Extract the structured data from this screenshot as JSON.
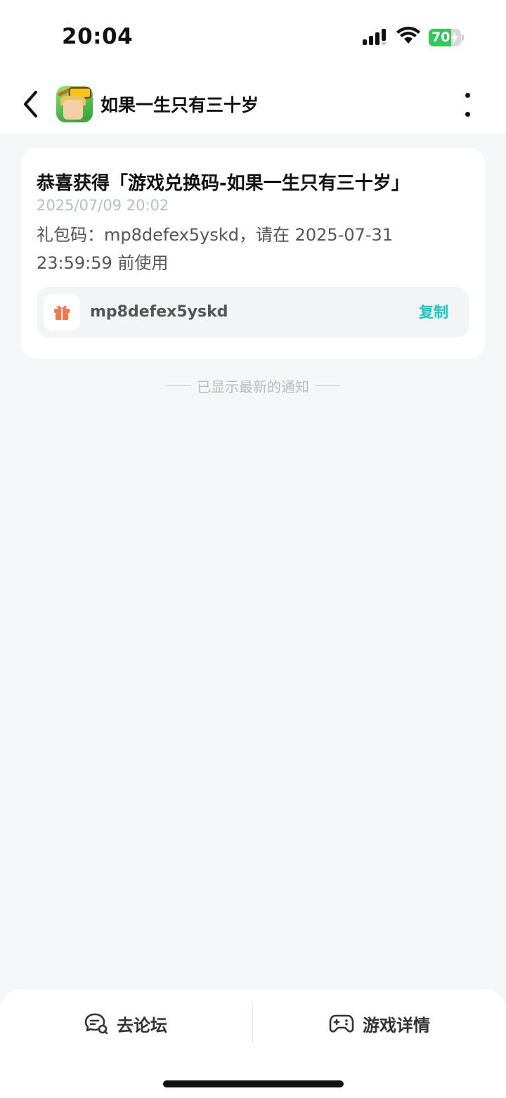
{
  "status_bar": {
    "time": "20:04",
    "battery_level": "70",
    "battery_fraction": 0.7,
    "signal_icon": "cellular-signal-icon",
    "wifi_icon": "wifi-icon"
  },
  "nav": {
    "title": "如果一生只有三十岁",
    "back_icon": "chevron-left-icon",
    "more_icon": "more-vertical-icon"
  },
  "notification": {
    "title": "恭喜获得「游戏兑换码-如果一生只有三十岁」",
    "time": "2025/07/09 20:02",
    "body": "礼包码：mp8defex5yskd，请在 2025-07-31 23:59:59 前使用",
    "code": "mp8defex5yskd",
    "copy_label": "复制",
    "gift_icon": "gift-icon"
  },
  "end_notice": "已显示最新的通知",
  "bottom": {
    "forum_label": "去论坛",
    "game_detail_label": "游戏详情",
    "forum_icon": "chat-bubble-icon",
    "game_icon": "gamepad-icon"
  },
  "colors": {
    "accent": "#18c8c0",
    "gift": "#f4794a",
    "battery_green": "#34c759",
    "page_background": "#f5f6f8"
  }
}
